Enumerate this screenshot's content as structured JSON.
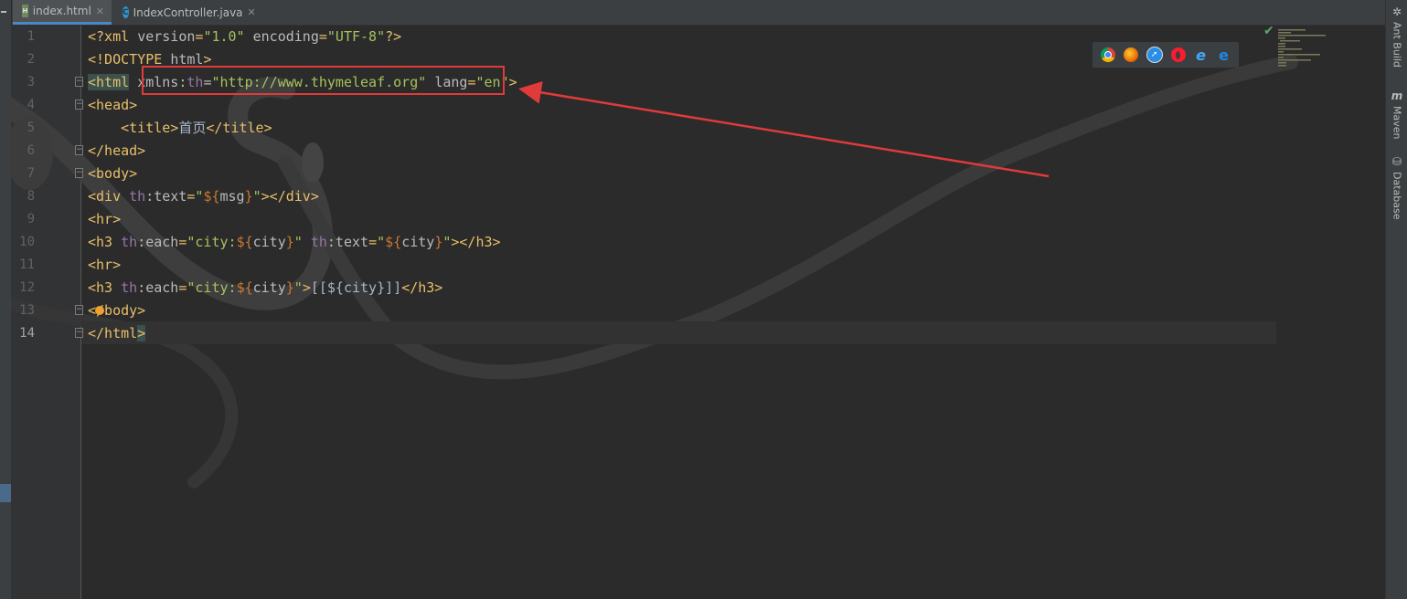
{
  "tabs": [
    {
      "label": "index.html",
      "icon": "html-file-icon",
      "active": true
    },
    {
      "label": "IndexController.java",
      "icon": "java-class-icon",
      "active": false
    }
  ],
  "right_tools": [
    {
      "label": "Ant Build",
      "icon": "ant-icon"
    },
    {
      "label": "Maven",
      "icon": "maven-icon"
    },
    {
      "label": "Database",
      "icon": "database-icon"
    }
  ],
  "browsers": [
    "chrome-icon",
    "firefox-icon",
    "safari-icon",
    "opera-icon",
    "internet-explorer-icon",
    "edge-icon"
  ],
  "current_line": 14,
  "lines": [
    {
      "n": 1,
      "fold": false,
      "tokens": [
        [
          "tag",
          "<?xml "
        ],
        [
          "attr",
          "version"
        ],
        [
          "tag",
          "="
        ],
        [
          "str",
          "\"1.0\""
        ],
        [
          "tag",
          " "
        ],
        [
          "attr",
          "encoding"
        ],
        [
          "tag",
          "="
        ],
        [
          "str",
          "\"UTF-8\""
        ],
        [
          "tag",
          "?>"
        ]
      ]
    },
    {
      "n": 2,
      "fold": false,
      "tokens": [
        [
          "tag",
          "<!DOCTYPE "
        ],
        [
          "attr",
          "html"
        ],
        [
          "tag",
          ">"
        ]
      ]
    },
    {
      "n": 3,
      "fold": true,
      "tokens": [
        [
          "hl",
          "<html"
        ],
        [
          "tag",
          " "
        ],
        [
          "attr",
          "xmlns:"
        ],
        [
          "ns",
          "th"
        ],
        [
          "attr",
          "="
        ],
        [
          "str",
          "\"http://www.thymeleaf.org\""
        ],
        [
          "tag",
          " "
        ],
        [
          "attr",
          "lang"
        ],
        [
          "tag",
          "="
        ],
        [
          "str",
          "\"en\""
        ],
        [
          "tag",
          ">"
        ]
      ]
    },
    {
      "n": 4,
      "fold": true,
      "tokens": [
        [
          "tag",
          "<head>"
        ]
      ]
    },
    {
      "n": 5,
      "fold": false,
      "tokens": [
        [
          "text",
          "    "
        ],
        [
          "tag",
          "<title>"
        ],
        [
          "cn",
          "首页"
        ],
        [
          "tag",
          "</title>"
        ]
      ]
    },
    {
      "n": 6,
      "fold": true,
      "tokens": [
        [
          "tag",
          "</head>"
        ]
      ]
    },
    {
      "n": 7,
      "fold": true,
      "tokens": [
        [
          "tag",
          "<body>"
        ]
      ]
    },
    {
      "n": 8,
      "fold": false,
      "tokens": [
        [
          "tag",
          "<div "
        ],
        [
          "ns",
          "th"
        ],
        [
          "attr",
          ":text"
        ],
        [
          "tag",
          "="
        ],
        [
          "str",
          "\""
        ],
        [
          "expr",
          "${"
        ],
        [
          "attr",
          "msg"
        ],
        [
          "expr",
          "}"
        ],
        [
          "str",
          "\""
        ],
        [
          "tag",
          "></div>"
        ]
      ]
    },
    {
      "n": 9,
      "fold": false,
      "tokens": [
        [
          "tag",
          "<hr>"
        ]
      ]
    },
    {
      "n": 10,
      "fold": false,
      "tokens": [
        [
          "tag",
          "<h3 "
        ],
        [
          "ns",
          "th"
        ],
        [
          "attr",
          ":each"
        ],
        [
          "tag",
          "="
        ],
        [
          "str",
          "\"city:"
        ],
        [
          "expr",
          "${"
        ],
        [
          "attr",
          "city"
        ],
        [
          "expr",
          "}"
        ],
        [
          "str",
          "\""
        ],
        [
          "tag",
          " "
        ],
        [
          "ns",
          "th"
        ],
        [
          "attr",
          ":text"
        ],
        [
          "tag",
          "="
        ],
        [
          "str",
          "\""
        ],
        [
          "expr",
          "${"
        ],
        [
          "attr",
          "city"
        ],
        [
          "expr",
          "}"
        ],
        [
          "str",
          "\""
        ],
        [
          "tag",
          "></h3>"
        ]
      ]
    },
    {
      "n": 11,
      "fold": false,
      "tokens": [
        [
          "tag",
          "<hr>"
        ]
      ]
    },
    {
      "n": 12,
      "fold": false,
      "tokens": [
        [
          "tag",
          "<h3 "
        ],
        [
          "ns",
          "th"
        ],
        [
          "attr",
          ":each"
        ],
        [
          "tag",
          "="
        ],
        [
          "str",
          "\"city:"
        ],
        [
          "expr",
          "${"
        ],
        [
          "attr",
          "city"
        ],
        [
          "expr",
          "}"
        ],
        [
          "str",
          "\""
        ],
        [
          "tag",
          ">"
        ],
        [
          "text",
          "[[${city}]]"
        ],
        [
          "tag",
          "</h3>"
        ]
      ]
    },
    {
      "n": 13,
      "fold": true,
      "tokens": [
        [
          "tag",
          "</body>"
        ]
      ]
    },
    {
      "n": 14,
      "fold": true,
      "tokens": [
        [
          "tag",
          "</html"
        ],
        [
          "hl",
          ">"
        ]
      ]
    }
  ]
}
